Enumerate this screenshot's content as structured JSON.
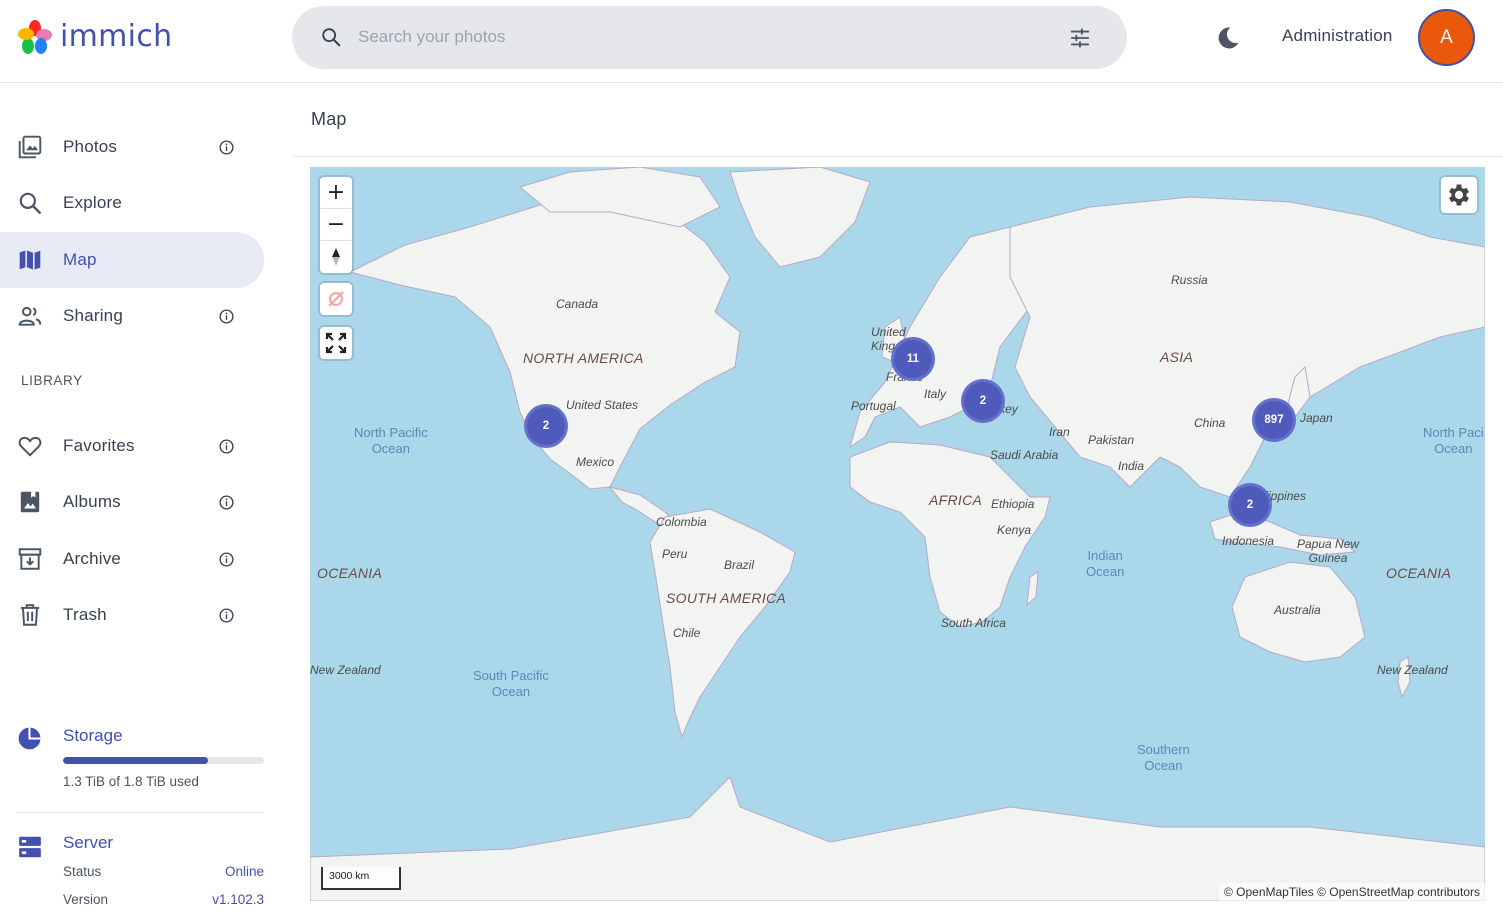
{
  "app": {
    "name": "immich"
  },
  "header": {
    "search_placeholder": "Search your photos",
    "admin_label": "Administration",
    "avatar_initial": "A"
  },
  "sidebar": {
    "items": [
      {
        "label": "Photos",
        "icon": "photos-icon",
        "has_info": true
      },
      {
        "label": "Explore",
        "icon": "search-icon",
        "has_info": false
      },
      {
        "label": "Map",
        "icon": "map-icon",
        "has_info": false,
        "active": true
      },
      {
        "label": "Sharing",
        "icon": "people-icon",
        "has_info": true
      }
    ],
    "library_label": "LIBRARY",
    "library_items": [
      {
        "label": "Favorites",
        "icon": "heart-icon",
        "has_info": true
      },
      {
        "label": "Albums",
        "icon": "album-icon",
        "has_info": true
      },
      {
        "label": "Archive",
        "icon": "archive-icon",
        "has_info": true
      },
      {
        "label": "Trash",
        "icon": "trash-icon",
        "has_info": true
      }
    ],
    "storage": {
      "title": "Storage",
      "usage_text": "1.3 TiB of 1.8 TiB used",
      "used_fraction": 0.72
    },
    "server": {
      "title": "Server",
      "status_label": "Status",
      "status_value": "Online",
      "version_label": "Version",
      "version_value": "v1.102.3"
    }
  },
  "main": {
    "title": "Map",
    "map": {
      "clusters": [
        "11",
        "2",
        "2",
        "897",
        "2"
      ],
      "labels": {
        "canada": "Canada",
        "north_america": "NORTH AMERICA",
        "united_states": "United States",
        "mexico": "Mexico",
        "north_pacific": [
          "North Pacific",
          "Ocean"
        ],
        "colombia": "Colombia",
        "peru": "Peru",
        "brazil": "Brazil",
        "south_america": "SOUTH AMERICA",
        "chile": "Chile",
        "south_pacific": [
          "South Pacific",
          "Ocean"
        ],
        "oceania_left": "OCEANIA",
        "new_zealand_left": "New Zealand",
        "united_kingdom": [
          "United",
          "Kingdom"
        ],
        "france": "France",
        "portugal": "Portugal",
        "italy": "Italy",
        "turkey": "Turkey",
        "russia": "Russia",
        "asia": "ASIA",
        "iran": "Iran",
        "pakistan": "Pakistan",
        "saudi_arabia": "Saudi Arabia",
        "india": "India",
        "china": "China",
        "japan": "Japan",
        "africa": "AFRICA",
        "ethiopia": "Ethiopia",
        "kenya": "Kenya",
        "south_africa": "South Africa",
        "indian_ocean": [
          "Indian",
          "Ocean"
        ],
        "philippines": "Philippines",
        "indonesia": "Indonesia",
        "papua": [
          "Papua New",
          "Guinea"
        ],
        "oceania_right": "OCEANIA",
        "australia": "Australia",
        "new_zealand_right": "New Zealand",
        "north_pacific_right": [
          "North Paci",
          "Ocean"
        ],
        "southern_ocean": [
          "Southern",
          "Ocean"
        ]
      },
      "scale_label": "3000 km",
      "attribution": "© OpenMapTiles © OpenStreetMap contributors"
    }
  },
  "colors": {
    "accent": "#4250af",
    "avatar": "#ea580c",
    "water": "#aad8ea",
    "land": "#f2f4f1",
    "cluster": "#4f5bba"
  }
}
